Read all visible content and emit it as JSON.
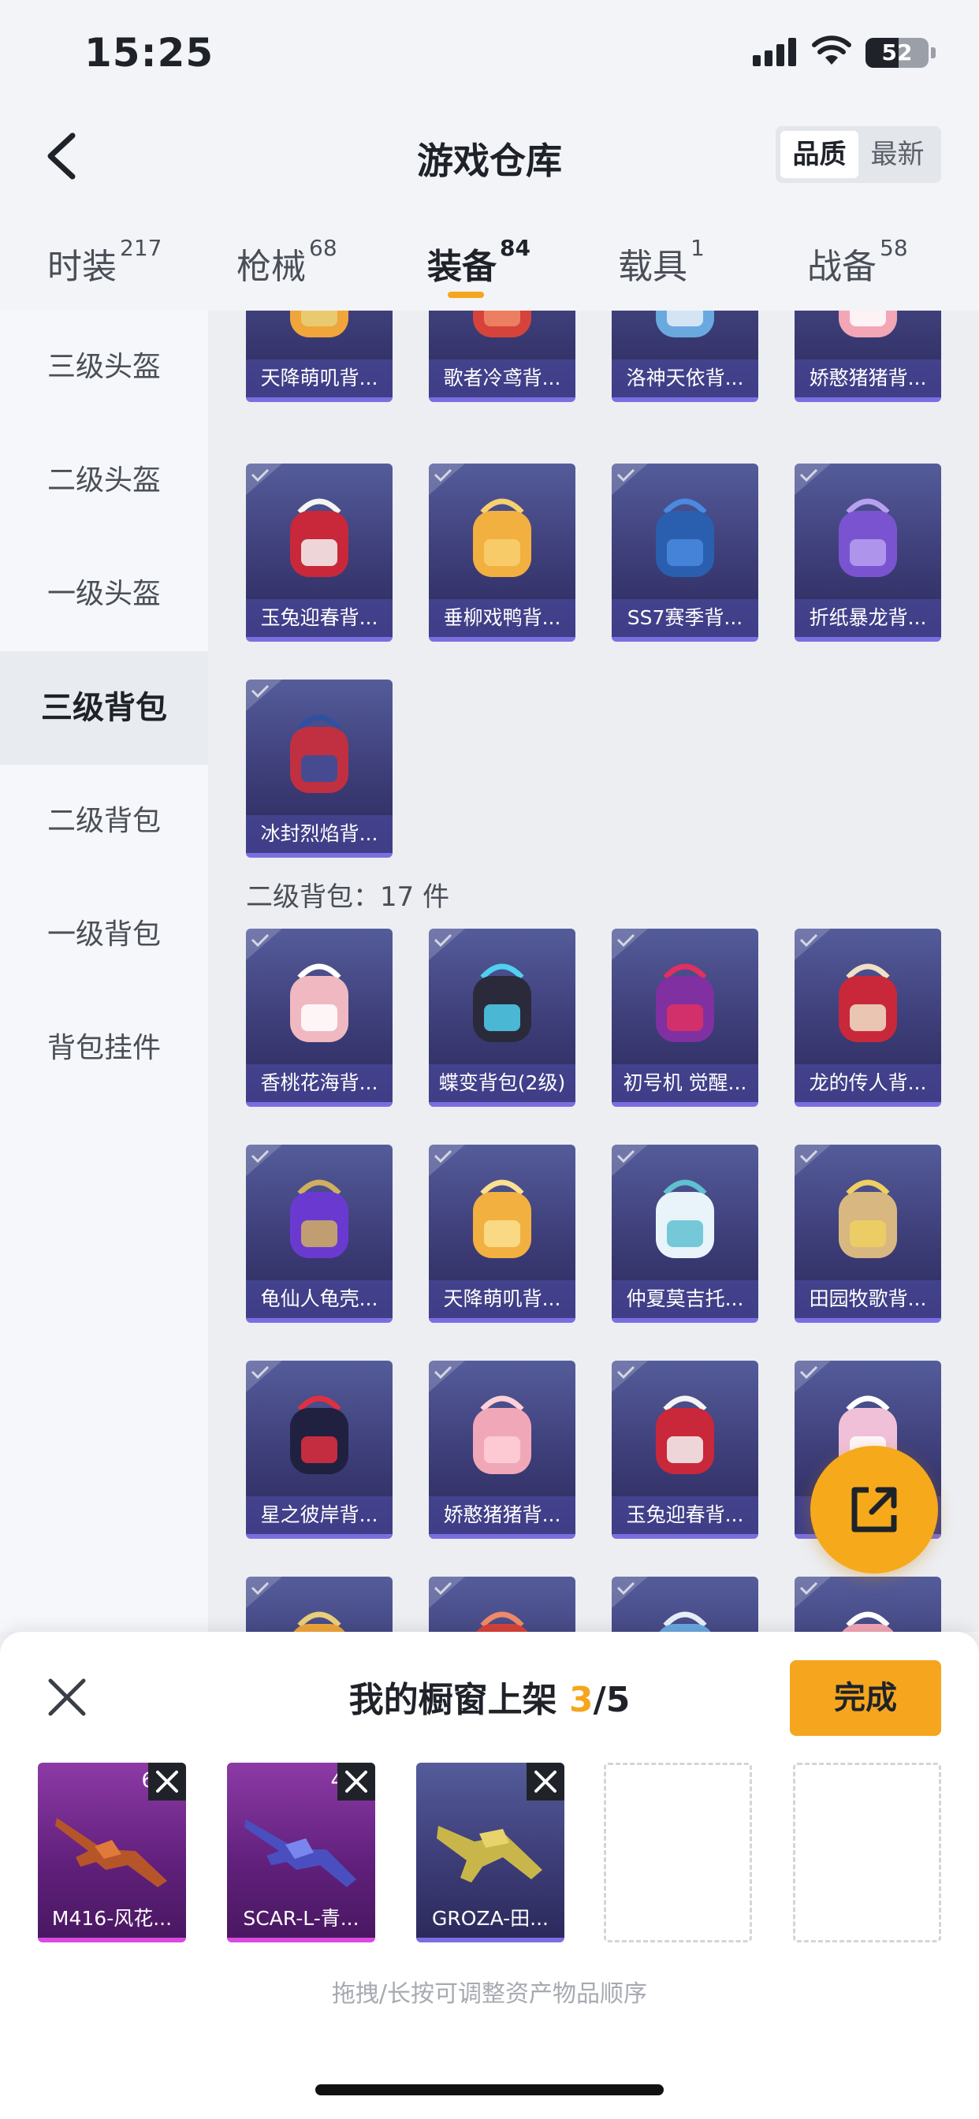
{
  "status": {
    "time": "15:25",
    "battery": "52"
  },
  "header": {
    "title": "游戏仓库",
    "sort_options": [
      "品质",
      "最新"
    ]
  },
  "tabs": [
    {
      "label": "时装",
      "count": "217"
    },
    {
      "label": "枪械",
      "count": "68"
    },
    {
      "label": "装备",
      "count": "84"
    },
    {
      "label": "载具",
      "count": "1"
    },
    {
      "label": "战备",
      "count": "58"
    }
  ],
  "sidebar": [
    "三级头盔",
    "二级头盔",
    "一级头盔",
    "三级背包",
    "二级背包",
    "一级背包",
    "背包挂件"
  ],
  "level3_backpacks": [
    "天降萌叽背...",
    "歌者冷鸢背...",
    "洛神天依背...",
    "娇憨猪猪背...",
    "玉兔迎春背...",
    "垂柳戏鸭背...",
    "SS7赛季背...",
    "折纸暴龙背...",
    "冰封烈焰背..."
  ],
  "level2_section": "二级背包：17 件",
  "level2_backpacks": [
    "香桃花海背...",
    "蝶变背包(2级)",
    "初号机 觉醒...",
    "龙的传人背...",
    "龟仙人龟壳...",
    "天降萌叽背...",
    "仲夏莫吉托...",
    "田园牧歌背...",
    "星之彼岸背...",
    "娇憨猪猪背...",
    "玉兔迎春背...",
    "",
    "",
    "",
    "",
    ""
  ],
  "showcase": {
    "title_prefix": "我的橱窗上架 ",
    "count": "3",
    "total": "/5",
    "done": "完成",
    "slots": [
      {
        "label": "M416-风花...",
        "level": "6"
      },
      {
        "label": "SCAR-L-青...",
        "level": "4"
      },
      {
        "label": "GROZA-田...",
        "level": ""
      }
    ],
    "hint": "拖拽/长按可调整资产物品顺序"
  }
}
